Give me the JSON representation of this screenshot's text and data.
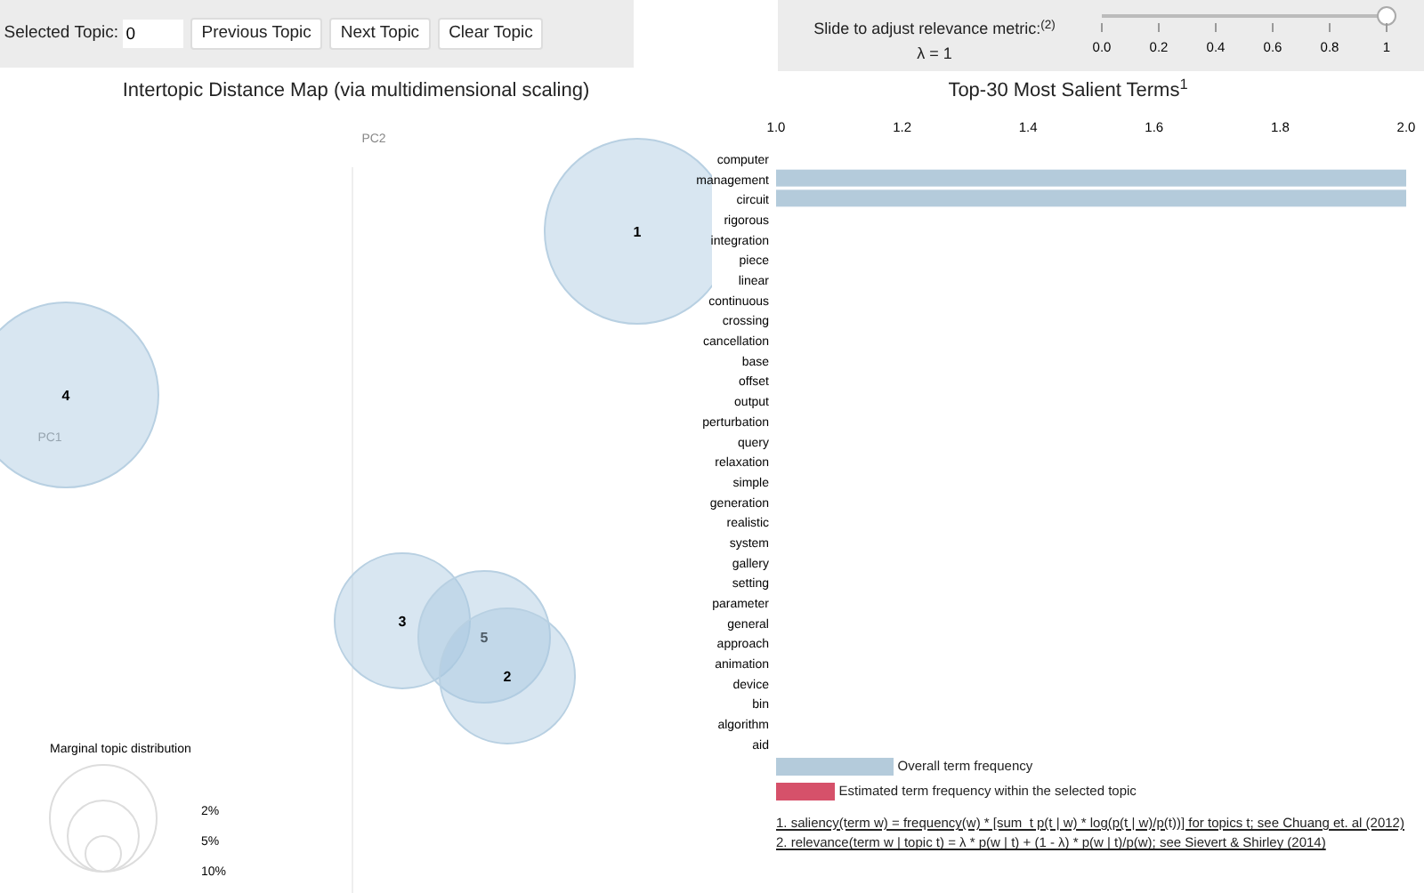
{
  "controls": {
    "topic_label": "Selected Topic:",
    "topic_value": "0",
    "buttons": [
      "Previous Topic",
      "Next Topic",
      "Clear Topic"
    ]
  },
  "relevance": {
    "label": "Slide to adjust relevance metric:$^{(2)}$",
    "lambda": "λ = 1",
    "level": 1,
    "ticks": [
      "0.0",
      "0.2",
      "0.4",
      "0.6",
      "0.8",
      "1"
    ]
  },
  "map": {
    "title": "Intertopic Distance Map (via multidimensional scaling)",
    "axis_x": "PC1",
    "axis_y": "PC2",
    "topics": [
      {
        "label": "1"
      },
      {
        "label": "4"
      },
      {
        "label": "3"
      },
      {
        "label": "5"
      },
      {
        "label": "2"
      }
    ],
    "marginal": {
      "title": "Marginal topic distribution",
      "sizes": [
        "2%",
        "5%",
        "10%"
      ]
    }
  },
  "terms": {
    "title": "Top-30 Most Salient Terms$^{1}$",
    "chart_data": {
      "type": "bar",
      "orientation": "horizontal",
      "xlim": [
        1.0,
        2.0
      ],
      "xticks": [
        {
          "value": 1.0,
          "label": "1.0"
        },
        {
          "value": 1.2,
          "label": "1.2"
        },
        {
          "value": 1.4,
          "label": "1.4"
        },
        {
          "value": 1.6,
          "label": "1.6"
        },
        {
          "value": 1.8,
          "label": "1.8"
        },
        {
          "value": 2.0,
          "label": "2.0"
        }
      ],
      "categories": [
        "computer",
        "management",
        "circuit",
        "rigorous",
        "integration",
        "piece",
        "linear",
        "continuous",
        "crossing",
        "cancellation",
        "base",
        "offset",
        "output",
        "perturbation",
        "query",
        "relaxation",
        "simple",
        "generation",
        "realistic",
        "system",
        "gallery",
        "setting",
        "parameter",
        "general",
        "approach",
        "animation",
        "device",
        "bin",
        "algorithm",
        "aid"
      ],
      "series": [
        {
          "name": "Overall term frequency",
          "color": "#b4cbdb",
          "values": [
            null,
            2.0,
            2.0,
            null,
            null,
            null,
            null,
            null,
            null,
            null,
            null,
            null,
            null,
            null,
            null,
            null,
            null,
            null,
            null,
            null,
            null,
            null,
            null,
            null,
            null,
            null,
            null,
            null,
            null,
            null
          ]
        }
      ]
    },
    "legend": [
      {
        "label": "Estimated term frequency within the selected topic",
        "color": "#d6516a"
      }
    ],
    "footnotes": [
      "1. saliency(term w) = frequency(w) * [sum_t p(t | w) * log(p(t | w)/p(t))] for topics t; see Chuang et. al (2012)",
      "2. relevance(term w | topic t) = λ * p(w | t) + (1 - λ) * p(w | t)/p(w); see Sievert & Shirley (2014)"
    ]
  }
}
